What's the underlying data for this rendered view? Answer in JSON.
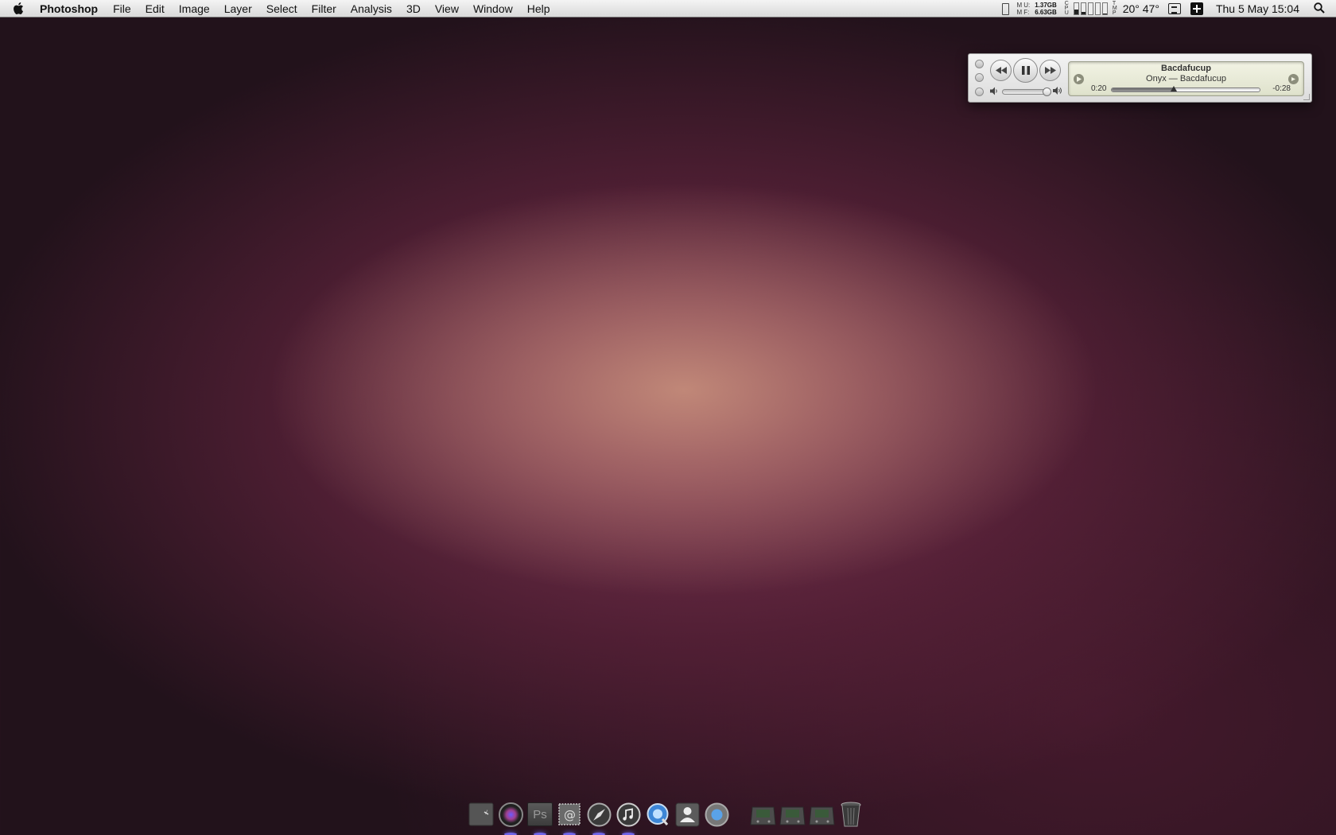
{
  "menubar": {
    "app_name": "Photoshop",
    "menus": [
      "File",
      "Edit",
      "Image",
      "Layer",
      "Select",
      "Filter",
      "Analysis",
      "3D",
      "View",
      "Window",
      "Help"
    ],
    "memory": {
      "used_label": "U:",
      "free_label": "F:",
      "used_value": "1.37GB",
      "free_value": "6.63GB",
      "row_labels": [
        "M",
        "M"
      ]
    },
    "cpu_label": [
      "C",
      "P",
      "U"
    ],
    "cpu_levels": [
      0.45,
      0.2,
      0.0,
      0.0,
      0.1
    ],
    "temp_label": [
      "T",
      "M",
      "P"
    ],
    "weather": "20° 47°",
    "datetime": "Thu 5 May  15:04"
  },
  "player": {
    "track_title": "Bacdafucup",
    "artist_album": "Onyx — Bacdafucup",
    "elapsed": "0:20",
    "remaining": "-0:28",
    "progress": 0.42,
    "volume": 0.95,
    "state": "playing"
  },
  "dock": {
    "apps": [
      {
        "name": "terminal",
        "color": "#5a5a5a"
      },
      {
        "name": "aperture",
        "color": "#2a2a2a"
      },
      {
        "name": "photoshop",
        "label": "Ps",
        "color": "#4a4a4a"
      },
      {
        "name": "mail",
        "color": "#5a5a5a"
      },
      {
        "name": "safari",
        "color": "#3a3a3a"
      },
      {
        "name": "itunes",
        "color": "#3a3a3a"
      },
      {
        "name": "quicktime",
        "color": "#3a7fd0"
      },
      {
        "name": "address-book",
        "color": "#5a5a5a"
      },
      {
        "name": "system-preferences",
        "color": "#4a90d8"
      }
    ],
    "folders": [
      {
        "name": "drive-1"
      },
      {
        "name": "drive-2"
      },
      {
        "name": "drive-3"
      },
      {
        "name": "trash"
      }
    ]
  }
}
